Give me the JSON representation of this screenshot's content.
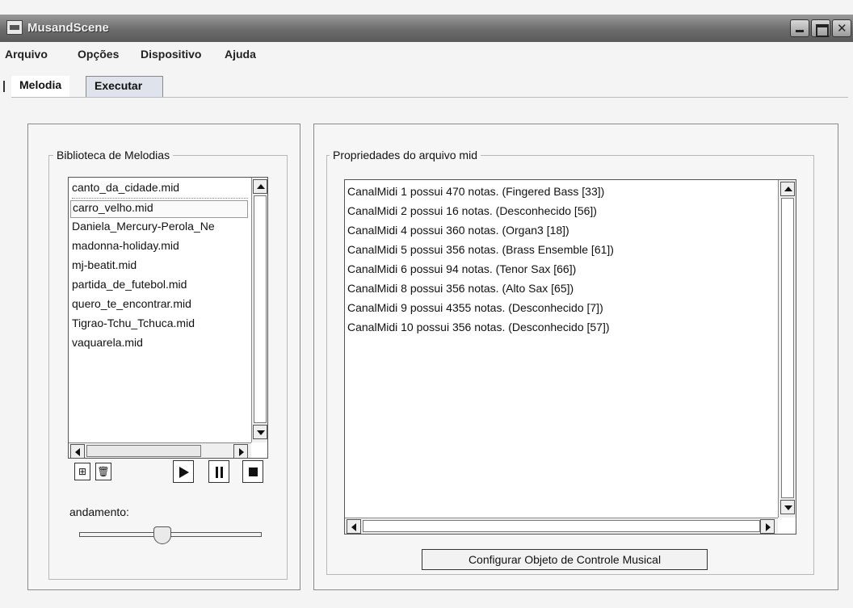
{
  "window": {
    "title": "MusandScene"
  },
  "menu": [
    "Arquivo",
    "Opções",
    "Dispositivo",
    "Ajuda"
  ],
  "tabs": {
    "active": "Melodia",
    "other": "Executar"
  },
  "library": {
    "title": "Biblioteca de Melodias",
    "files": [
      "canto_da_cidade.mid",
      "carro_velho.mid",
      "Daniela_Mercury-Perola_Ne",
      "madonna-holiday.mid",
      "mj-beatit.mid",
      "partida_de_futebol.mid",
      "quero_te_encontrar.mid",
      "Tigrao-Tchu_Tchuca.mid",
      "vaquarela.mid"
    ],
    "selected_index": 1
  },
  "controls": {
    "tempo_label": "andamento:",
    "tempo_level": 0.45
  },
  "properties": {
    "title": "Propriedades do arquivo mid",
    "lines": [
      "CanalMidi 1 possui 470 notas. (Fingered Bass [33])",
      "CanalMidi 2 possui 16 notas. (Desconhecido [56])",
      "CanalMidi 4 possui 360 notas. (Organ3 [18])",
      "CanalMidi 5 possui 356 notas. (Brass Ensemble [61])",
      "CanalMidi 6 possui 94 notas. (Tenor Sax [66])",
      "CanalMidi 8 possui 356 notas. (Alto Sax [65])",
      "CanalMidi 9 possui 4355 notas. (Desconhecido [7])",
      "CanalMidi 10 possui 356 notas. (Desconhecido [57])"
    ]
  },
  "config_button": "Configurar Objeto de Controle Musical",
  "icons": {
    "app": "app-icon",
    "add": "add-file-icon",
    "delete": "trash-icon",
    "play": "play-icon",
    "pause": "pause-icon",
    "stop": "stop-icon"
  },
  "colors": {
    "titlebar": "#6c6c6c",
    "window_bg": "#f4f4f4",
    "tab_inactive": "#dfe4ec"
  }
}
